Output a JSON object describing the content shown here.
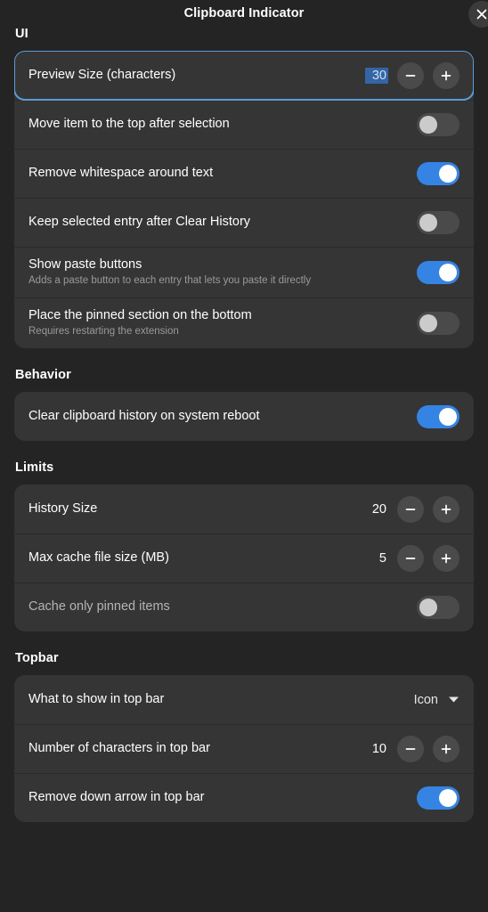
{
  "window": {
    "title": "Clipboard Indicator",
    "close_label": "Close"
  },
  "sections": [
    {
      "header": "UI",
      "rows": [
        {
          "title": "Preview Size (characters)",
          "subtitle": "",
          "control": "spin",
          "value": "30",
          "focused": true,
          "selected_value": true
        },
        {
          "title": "Move item to the top after selection",
          "subtitle": "",
          "control": "switch",
          "value": "off"
        },
        {
          "title": "Remove whitespace around text",
          "subtitle": "",
          "control": "switch",
          "value": "on"
        },
        {
          "title": "Keep selected entry after Clear History",
          "subtitle": "",
          "control": "switch",
          "value": "off"
        },
        {
          "title": "Show paste buttons",
          "subtitle": "Adds a paste button to each entry that lets you paste it directly",
          "control": "switch",
          "value": "on"
        },
        {
          "title": "Place the pinned section on the bottom",
          "subtitle": "Requires restarting the extension",
          "control": "switch",
          "value": "off"
        }
      ]
    },
    {
      "header": "Behavior",
      "rows": [
        {
          "title": "Clear clipboard history on system reboot",
          "subtitle": "",
          "control": "switch",
          "value": "on"
        }
      ]
    },
    {
      "header": "Limits",
      "rows": [
        {
          "title": "History Size",
          "subtitle": "",
          "control": "spin",
          "value": "20"
        },
        {
          "title": "Max cache file size (MB)",
          "subtitle": "",
          "control": "spin",
          "value": "5"
        },
        {
          "title": "Cache only pinned items",
          "subtitle": "",
          "control": "switch",
          "value": "off",
          "dimmed": true
        }
      ]
    },
    {
      "header": "Topbar",
      "rows": [
        {
          "title": "What to show in top bar",
          "subtitle": "",
          "control": "dropdown",
          "value": "Icon"
        },
        {
          "title": "Number of characters in top bar",
          "subtitle": "",
          "control": "spin",
          "value": "10"
        },
        {
          "title": "Remove down arrow in top bar",
          "subtitle": "",
          "control": "switch",
          "value": "on"
        }
      ]
    }
  ],
  "colors": {
    "page_background": "#242424",
    "group_background": "#353535",
    "accent": "#3584e4",
    "focus_ring": "#5b9ad5",
    "selection": "#3465a4",
    "control_background": "#4a4a4a"
  }
}
